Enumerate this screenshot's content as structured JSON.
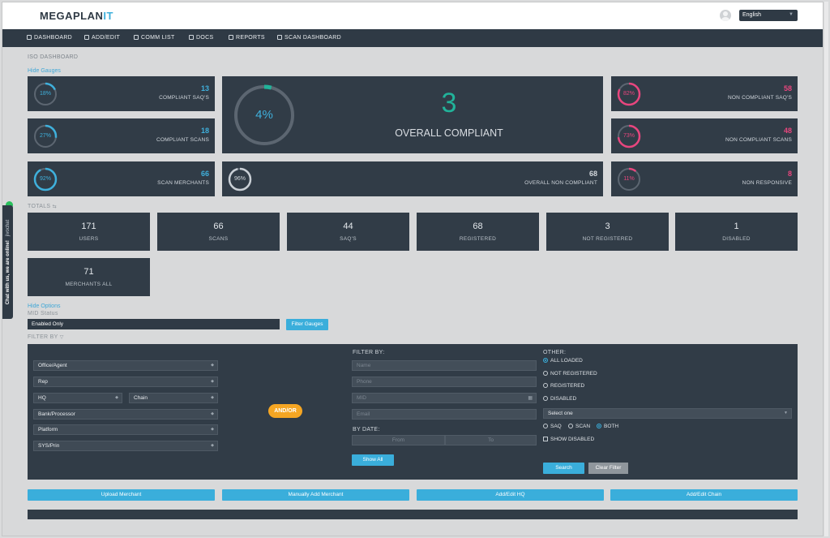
{
  "header": {
    "logo_main": "MEGAPLAN",
    "logo_accent": "IT",
    "language": "English"
  },
  "nav": [
    {
      "label": "DASHBOARD"
    },
    {
      "label": "ADD/EDIT"
    },
    {
      "label": "COMM LIST"
    },
    {
      "label": "DOCS"
    },
    {
      "label": "REPORTS"
    },
    {
      "label": "SCAN DASHBOARD"
    }
  ],
  "page_title": "ISO DASHBOARD",
  "hide_gauges": "Hide Gauges",
  "gauges": {
    "compliant_saqs": {
      "percent": 0.18,
      "percent_label": "18%",
      "count": "13",
      "label": "COMPLIANT SAQ'S"
    },
    "compliant_scans": {
      "percent": 0.27,
      "percent_label": "27%",
      "count": "18",
      "label": "COMPLIANT SCANS"
    },
    "scan_merchants": {
      "percent": 0.92,
      "percent_label": "92%",
      "count": "66",
      "label": "SCAN MERCHANTS"
    },
    "overall": {
      "percent": 0.04,
      "percent_label": "4%",
      "count": "3",
      "label": "OVERALL COMPLIANT"
    },
    "overall_non": {
      "percent": 0.96,
      "percent_label": "96%",
      "count": "68",
      "label": "OVERALL NON COMPLIANT"
    },
    "non_compliant_saqs": {
      "percent": 0.82,
      "percent_label": "82%",
      "count": "58",
      "label": "NON COMPLIANT SAQ'S"
    },
    "non_compliant_scans": {
      "percent": 0.73,
      "percent_label": "73%",
      "count": "48",
      "label": "NON COMPLIANT SCANS"
    },
    "non_responsive": {
      "percent": 0.11,
      "percent_label": "11%",
      "count": "8",
      "label": "NON RESPONSIVE"
    }
  },
  "colors": {
    "blue": "#3fb0dc",
    "pink": "#e8467e",
    "teal": "#21b39a",
    "ring": "#5c6671"
  },
  "totals_label": "TOTALS",
  "totals": [
    {
      "value": "171",
      "label": "USERS"
    },
    {
      "value": "66",
      "label": "SCANS"
    },
    {
      "value": "44",
      "label": "SAQ'S"
    },
    {
      "value": "68",
      "label": "REGISTERED"
    },
    {
      "value": "3",
      "label": "NOT REGISTERED"
    },
    {
      "value": "1",
      "label": "DISABLED"
    },
    {
      "value": "71",
      "label": "MERCHANTS ALL"
    }
  ],
  "options": {
    "hide_options": "Hide Options",
    "mid_status_label": "MID Status",
    "mid_status_value": "Enabled Only",
    "filter_gauges": "Filter Gauges",
    "filter_by_label": "FILTER BY"
  },
  "filter_left": {
    "office_agent": "Office/Agent",
    "rep": "Rep",
    "hq": "HQ",
    "chain": "Chain",
    "bank": "Bank/Processor",
    "platform": "Platform",
    "sys_prin": "SYS/Prin",
    "andor": "AND/OR"
  },
  "filter_mid": {
    "title": "FILTER BY:",
    "name_ph": "Name",
    "phone_ph": "Phone",
    "mid_ph": "MID",
    "email_ph": "Email",
    "by_date": "BY DATE:",
    "from_ph": "From",
    "to_ph": "To",
    "show_all": "Show All"
  },
  "filter_right": {
    "title": "OTHER:",
    "all_loaded": "ALL LOADED",
    "not_registered": "NOT REGISTERED",
    "registered": "REGISTERED",
    "disabled": "DISABLED",
    "select_one": "Select one",
    "saq": "SAQ",
    "scan": "SCAN",
    "both": "BOTH",
    "show_disabled": "SHOW DISABLED",
    "search": "Search",
    "clear_filter": "Clear Filter"
  },
  "actions": {
    "upload_merchant": "Upload Merchant",
    "manual_add": "Manually Add Merchant",
    "add_edit_hq": "Add/Edit HQ",
    "add_edit_chain": "Add/Edit Chain"
  },
  "chat": {
    "text": "Chat with us, we are online!",
    "brand": "jivochat"
  }
}
